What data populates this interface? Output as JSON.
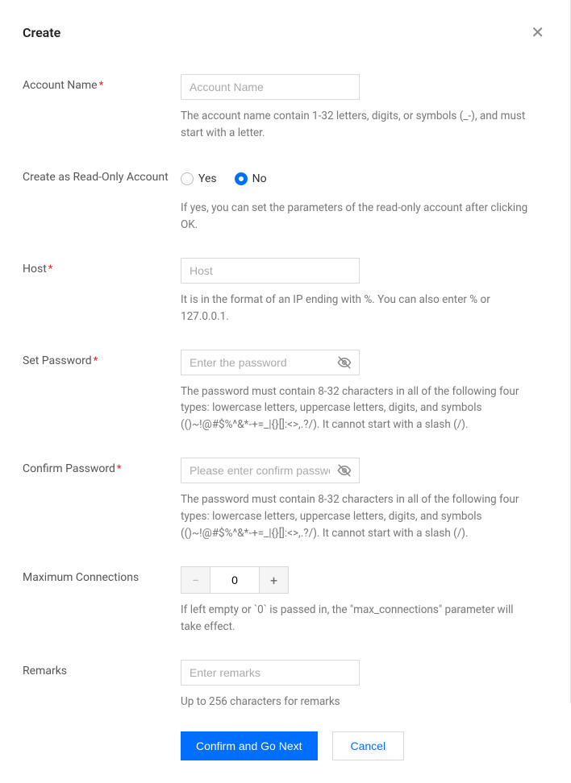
{
  "title": "Create",
  "fields": {
    "account_name": {
      "label": "Account Name",
      "required": true,
      "placeholder": "Account Name",
      "value": "",
      "hint": "The account name contain 1-32 letters, digits, or symbols (_-), and must start with a letter."
    },
    "read_only": {
      "label": "Create as Read-Only Account",
      "options": {
        "yes": "Yes",
        "no": "No"
      },
      "selected": "no",
      "hint": "If yes, you can set the parameters of the read-only account after clicking OK."
    },
    "host": {
      "label": "Host",
      "required": true,
      "placeholder": "Host",
      "value": "",
      "hint": "It is in the format of an IP ending with %. You can also enter % or 127.0.0.1."
    },
    "set_password": {
      "label": "Set Password",
      "required": true,
      "placeholder": "Enter the password",
      "value": "",
      "hint": "The password must contain 8-32 characters in all of the following four types: lowercase letters, uppercase letters, digits, and symbols (()~!@#$%^&*-+=_|{}[]:<>,.?/). It cannot start with a slash (/)."
    },
    "confirm_password": {
      "label": "Confirm Password",
      "required": true,
      "placeholder": "Please enter confirm password",
      "value": "",
      "hint": "The password must contain 8-32 characters in all of the following four types: lowercase letters, uppercase letters, digits, and symbols (()~!@#$%^&*-+=_|{}[]:<>,.?/). It cannot start with a slash (/)."
    },
    "max_connections": {
      "label": "Maximum Connections",
      "value": "0",
      "hint": "If left empty or `0` is passed in, the \"max_connections\" parameter will take effect."
    },
    "remarks": {
      "label": "Remarks",
      "placeholder": "Enter remarks",
      "value": "",
      "hint": "Up to 256 characters for remarks"
    }
  },
  "buttons": {
    "confirm": "Confirm and Go Next",
    "cancel": "Cancel"
  }
}
